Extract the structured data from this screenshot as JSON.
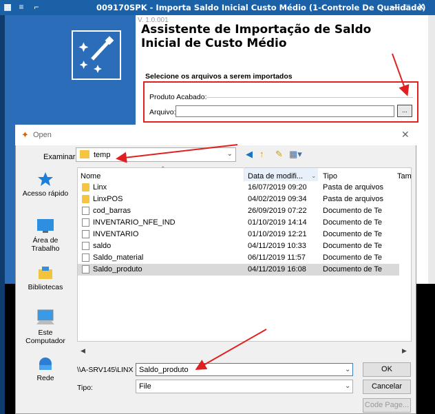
{
  "window": {
    "title": "009170SPK - Importa Saldo Inicial Custo Médio (1-Controle De Qualidade)",
    "minimize": "—",
    "maximize": "□",
    "close": "X"
  },
  "wizard": {
    "version": "V. 1.0.001",
    "title_line1": "Assistente de Importação de Saldo",
    "title_line2": "Inicial de Custo Médio",
    "select_label": "Selecione os arquivos a serem importados",
    "group_label": "Produto Acabado:",
    "arquivo_label": "Arquivo:",
    "arquivo_value": "",
    "browse_label": "..."
  },
  "dialog": {
    "title": "Open",
    "close": "✕",
    "examinar_label": "Examinar:",
    "current_folder": "temp",
    "places": [
      {
        "label": "Acesso rápido",
        "icon": "star-icon"
      },
      {
        "label": "Área de Trabalho",
        "icon": "desktop-icon"
      },
      {
        "label": "Bibliotecas",
        "icon": "library-icon"
      },
      {
        "label": "Este Computador",
        "icon": "computer-icon"
      },
      {
        "label": "Rede",
        "icon": "network-icon"
      }
    ],
    "columns": {
      "name": "Nome",
      "date": "Data de modifi...",
      "type": "Tipo",
      "size": "Tam"
    },
    "files": [
      {
        "name": "Linx",
        "date": "16/07/2019 09:20",
        "type": "Pasta de arquivos",
        "kind": "folder"
      },
      {
        "name": "LinxPOS",
        "date": "04/02/2019 09:34",
        "type": "Pasta de arquivos",
        "kind": "folder"
      },
      {
        "name": "cod_barras",
        "date": "26/09/2019 07:22",
        "type": "Documento de Te",
        "kind": "doc"
      },
      {
        "name": "INVENTARIO_NFE_IND",
        "date": "01/10/2019 14:14",
        "type": "Documento de Te",
        "kind": "doc"
      },
      {
        "name": "INVENTARIO",
        "date": "01/10/2019 12:21",
        "type": "Documento de Te",
        "kind": "doc"
      },
      {
        "name": "saldo",
        "date": "04/11/2019 10:33",
        "type": "Documento de Te",
        "kind": "doc"
      },
      {
        "name": "Saldo_material",
        "date": "06/11/2019 11:57",
        "type": "Documento de Te",
        "kind": "doc"
      },
      {
        "name": "Saldo_produto",
        "date": "04/11/2019 16:08",
        "type": "Documento de Te",
        "kind": "doc",
        "selected": true
      }
    ],
    "filename_label": "\\\\A-SRV145\\LINX",
    "filename_value": "Saldo_produto",
    "tipo_label": "Tipo:",
    "tipo_value": "File",
    "ok_label": "OK",
    "cancel_label": "Cancelar",
    "codepage_label": "Code Page..."
  },
  "colors": {
    "titlebar": "#1a61a8",
    "wizard_panel": "#2b6db8",
    "annotation": "#e02020",
    "selected_row": "#d9d9d9"
  }
}
